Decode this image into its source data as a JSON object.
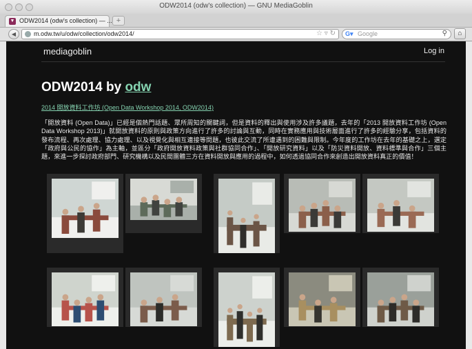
{
  "browser": {
    "window_title": "ODW2014 (odw's collection) — GNU MediaGoblin",
    "tab_label": "ODW2014 (odw's collection) — ...",
    "url": "m.odw.tw/u/odw/collection/odw2014/",
    "search_placeholder": "Google"
  },
  "site": {
    "brand": "mediagoblin",
    "login": "Log in"
  },
  "collection": {
    "title": "ODW2014 by",
    "owner": "odw",
    "subtitle": "2014 開放資料工作坊 (Open Data Workshop 2014, ODW2014)",
    "description": "「開放資料 (Open Data)」已經是個熱門話題、眾所周知的關鍵詞，但是資料的釋出與使用涉及許多議題，去年的「2013 開放資料工作坊 (Open Data Workshop 2013)」就開放資料的原則與政策方向進行了許多的討論與互動，同時在實務應用與技術層面進行了許多的經驗分享，包括資料的發布流程、再次處理、協力處理、以及視覺化與相互連接等問題，也彼此交流了所遭遇到的困難與限制。今年度的工作坊在去年的基礎之上，選定「政府與公民的協作」為主軸，並區分「政府開放資料政策與社群協同合作」、「開放研究資料」以及「防災資料開放、資料標準與合作」三個主題，來進一步探討政府部門、研究機構以及民間團體三方在資料開放與應用的過程中，如何透過協同合作來創造出開放資料真正的價值！"
  },
  "photos": [
    {
      "scene": "people-standing-table"
    },
    {
      "scene": "room-audience"
    },
    {
      "scene": "people-standing-table"
    },
    {
      "scene": "people-standing-group"
    },
    {
      "scene": "people-standing-group"
    },
    {
      "scene": "people-posing"
    },
    {
      "scene": "people-discussion"
    },
    {
      "scene": "two-men-standing"
    },
    {
      "scene": "men-presentation"
    },
    {
      "scene": "men-standing-dark"
    }
  ]
}
